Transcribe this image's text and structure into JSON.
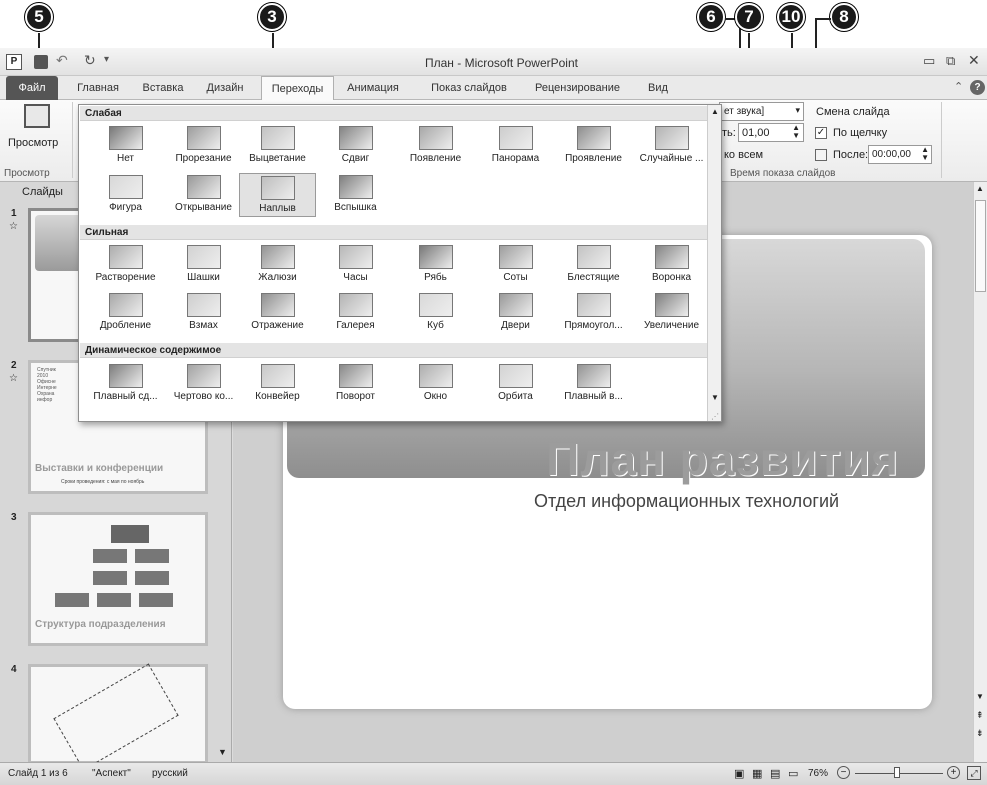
{
  "callouts": [
    {
      "label": "5"
    },
    {
      "label": "3"
    },
    {
      "label": "6"
    },
    {
      "label": "7"
    },
    {
      "label": "10"
    },
    {
      "label": "8"
    }
  ],
  "window": {
    "title": "План - Microsoft PowerPoint",
    "tabs": [
      "Файл",
      "Главная",
      "Вставка",
      "Дизайн",
      "Переходы",
      "Анимация",
      "Показ слайдов",
      "Рецензирование",
      "Вид"
    ],
    "active_tab": "Переходы"
  },
  "ribbon": {
    "preview_button": "Просмотр",
    "preview_group": "Просмотр",
    "sound_value": "[Без звука]",
    "sound_visible": "ет звука]",
    "duration_label": "ть:",
    "duration_value": "01,00",
    "apply_all": "ко всем",
    "advance_title": "Смена слайда",
    "on_click": "По щелчку",
    "after_label": "После:",
    "after_value": "00:00,00",
    "timing_group": "Время показа слайдов"
  },
  "gallery": {
    "sections": [
      {
        "title": "Слабая",
        "items": [
          "Нет",
          "Прорезание",
          "Выцветание",
          "Сдвиг",
          "Появление",
          "Панорама",
          "Проявление",
          "Случайные ...",
          "Фигура",
          "Открывание",
          "Наплыв",
          "Вспышка"
        ]
      },
      {
        "title": "Сильная",
        "items": [
          "Растворение",
          "Шашки",
          "Жалюзи",
          "Часы",
          "Рябь",
          "Соты",
          "Блестящие",
          "Воронка",
          "Дробление",
          "Взмах",
          "Отражение",
          "Галерея",
          "Куб",
          "Двери",
          "Прямоугол...",
          "Увеличение"
        ]
      },
      {
        "title": "Динамическое содержимое",
        "items": [
          "Плавный сд...",
          "Чертово ко...",
          "Конвейер",
          "Поворот",
          "Окно",
          "Орбита",
          "Плавный в..."
        ]
      }
    ],
    "selected": "Наплыв"
  },
  "leftpane": {
    "tab": "Слайды",
    "slides": [
      {
        "num": "1",
        "title": "",
        "sub": ""
      },
      {
        "num": "2",
        "title": "Выставки и конференции",
        "sub": "Сроки проведения: с мая по ноябрь",
        "bullets": "Спутник\n2010\nОфисне\nИнтерне\nОхрана\nинфор"
      },
      {
        "num": "3",
        "title": "Структура подразделения",
        "sub": ""
      },
      {
        "num": "4",
        "title": "",
        "sub": ""
      }
    ]
  },
  "slide": {
    "title": "План развития",
    "subtitle": "Отдел информационных технологий"
  },
  "status": {
    "slide_info": "Слайд 1 из 6",
    "theme": "\"Аспект\"",
    "language": "русский",
    "zoom": "76%"
  },
  "colors": {
    "file_tab": "#555555",
    "accent": "#1a1a1a"
  },
  "icons": [
    "save-icon",
    "undo-icon",
    "redo-icon",
    "minimize-icon",
    "restore-icon",
    "close-icon",
    "help-icon",
    "preview-icon"
  ]
}
